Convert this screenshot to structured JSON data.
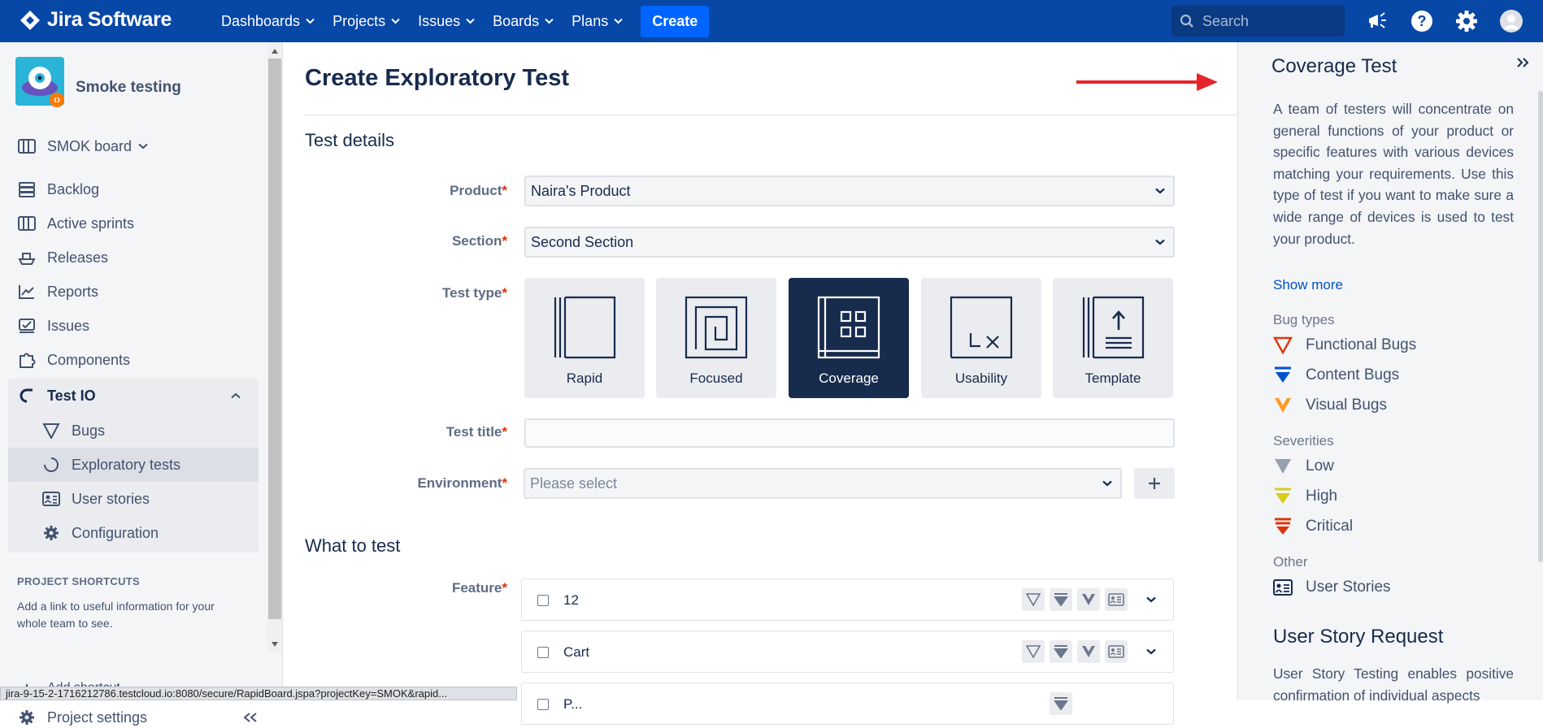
{
  "app": {
    "name": "Jira Software"
  },
  "topnav": {
    "menu": [
      "Dashboards",
      "Projects",
      "Issues",
      "Boards",
      "Plans"
    ],
    "create_label": "Create",
    "search_placeholder": "Search"
  },
  "sidebar": {
    "project_name": "Smoke testing",
    "board_label": "SMOK board",
    "items": [
      "Backlog",
      "Active sprints",
      "Releases",
      "Reports",
      "Issues",
      "Components"
    ],
    "group_label": "Test IO",
    "sub_items": [
      "Bugs",
      "Exploratory tests",
      "User stories",
      "Configuration"
    ],
    "shortcuts_title": "PROJECT SHORTCUTS",
    "shortcuts_text": "Add a link to useful information for your whole team to see.",
    "add_shortcut_label": "Add shortcut",
    "project_settings_label": "Project settings"
  },
  "status_url": "jira-9-15-2-1716212786.testcloud.io:8080/secure/RapidBoard.jspa?projectKey=SMOK&rapid...",
  "form": {
    "page_title": "Create Exploratory Test",
    "details_heading": "Test details",
    "required_mark": "*",
    "product_label": "Product",
    "product_value": "Naira's Product",
    "section_label": "Section",
    "section_value": "Second Section",
    "test_type_label": "Test type",
    "test_types": [
      "Rapid",
      "Focused",
      "Coverage",
      "Usability",
      "Template"
    ],
    "selected_type": "Coverage",
    "test_title_label": "Test title",
    "test_title_value": "",
    "environment_label": "Environment",
    "environment_placeholder": "Please select",
    "what_heading": "What to test",
    "feature_label": "Feature",
    "features": [
      "12",
      "Cart",
      "P..."
    ]
  },
  "panel": {
    "title": "Coverage Test",
    "description": "A team of testers will concentrate on general functions of your product or specific features with various devices matching your requirements. Use this type of test if you want to make sure a wide range of devices is used to test your product.",
    "show_more": "Show more",
    "bug_types_label": "Bug types",
    "bug_types": [
      "Functional Bugs",
      "Content Bugs",
      "Visual Bugs"
    ],
    "severities_label": "Severities",
    "severities": [
      "Low",
      "High",
      "Critical"
    ],
    "other_label": "Other",
    "other_items": [
      "User Stories"
    ],
    "user_story_title": "User Story Request",
    "user_story_desc": "User Story Testing enables positive confirmation of individual aspects"
  },
  "colors": {
    "nav": "#0747a6",
    "primary": "#0065ff",
    "selected_card": "#172b4d",
    "arrow": "#e5252a",
    "functional": "#de350b",
    "content": "#0052cc",
    "visual": "#ff991f",
    "low": "#97a0af",
    "high": "#d8cc1b",
    "critical": "#de350b"
  }
}
